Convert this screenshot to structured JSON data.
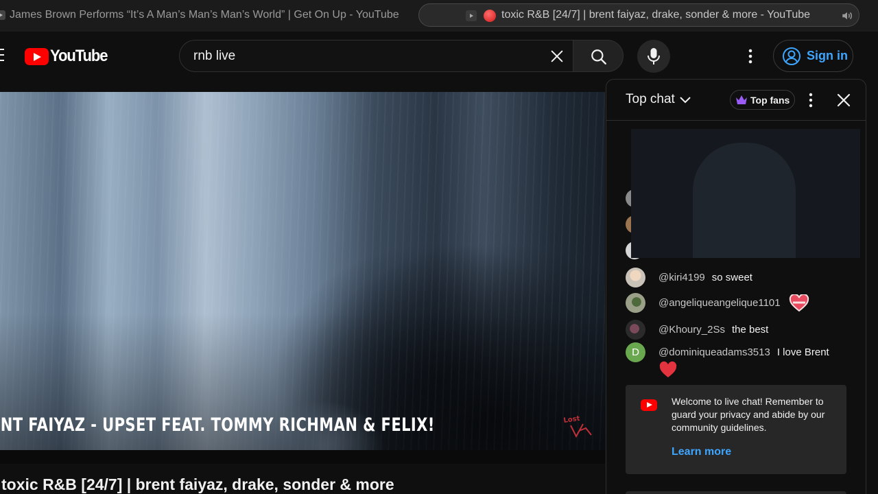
{
  "browser": {
    "tabs": [
      {
        "title": "James Brown Performs “It’s A Man’s Man’s Man’s World” | Get On Up - YouTube",
        "active": false
      },
      {
        "title": "toxic R&B [24/7] | brent faiyaz, drake, sonder & more - YouTube",
        "active": true,
        "recording": true,
        "audio": true
      }
    ]
  },
  "header": {
    "logo_text": "YouTube",
    "search": {
      "value": "rnb live",
      "placeholder": "Search"
    },
    "signin_label": "Sign in"
  },
  "video": {
    "caption": "ENT FAIYAZ - UPSET FEAT. TOMMY RICHMAN & FELIX!",
    "title": "toxic R&B [24/7] | brent faiyaz, drake, sonder & more"
  },
  "chat": {
    "mode_label": "Top chat",
    "top_fans_label": "Top fans",
    "messages": [
      {
        "author": "@kiri4199",
        "text": "so sweet",
        "badge": null
      },
      {
        "author": "@angeliqueangelique1101",
        "text": "",
        "badge": "heart-badge"
      },
      {
        "author": "@Khoury_2Ss",
        "text": "the best",
        "badge": null
      },
      {
        "author": "@dominiqueadams3513",
        "text": "I love Brent",
        "avatar_letter": "D",
        "emoji": "heart-icon"
      }
    ],
    "welcome": {
      "text": "Welcome to live chat! Remember to guard your privacy and abide by our community guidelines.",
      "link_label": "Learn more"
    }
  },
  "colors": {
    "accent_link": "#3ea6ff",
    "brand_red": "#ff0000",
    "background": "#0f0f0f"
  }
}
